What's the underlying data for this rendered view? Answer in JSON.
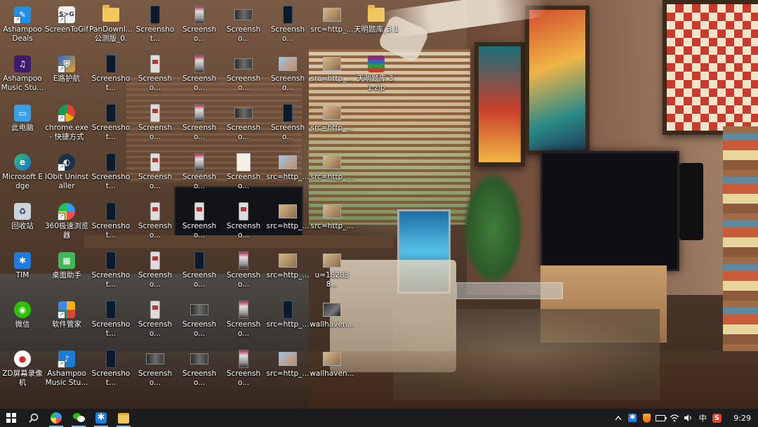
{
  "desktop": {
    "icons": [
      {
        "label": "Ashampoo Deals",
        "kind": "ashampoo"
      },
      {
        "label": "Ashampoo Music Stu...",
        "kind": "music"
      },
      {
        "label": "此电脑",
        "kind": "pc"
      },
      {
        "label": "Microsoft Edge",
        "kind": "edge"
      },
      {
        "label": "回收站",
        "kind": "recycle"
      },
      {
        "label": "TIM",
        "kind": "tim"
      },
      {
        "label": "微信",
        "kind": "wechat"
      },
      {
        "label": "ZD屏幕录像机",
        "kind": "zd"
      },
      {
        "label": "ScreenToGif",
        "kind": "stg"
      },
      {
        "label": "E路护航",
        "kind": "elu"
      },
      {
        "label": "chrome.exe - 快捷方式",
        "kind": "chrome"
      },
      {
        "label": "IObit Uninstaller",
        "kind": "iobit"
      },
      {
        "label": "360极速浏览器",
        "kind": "360"
      },
      {
        "label": "桌面助手",
        "kind": "desk"
      },
      {
        "label": "软件管家",
        "kind": "soft"
      },
      {
        "label": "Ashampoo Music Stu...",
        "kind": "ashampoo2"
      },
      {
        "label": "PanDownl... 公测版_0.0....",
        "kind": "folder"
      },
      {
        "label": "Screenshot...",
        "kind": "phone"
      },
      {
        "label": "Screenshot...",
        "kind": "phone"
      },
      {
        "label": "Screenshot...",
        "kind": "phone"
      },
      {
        "label": "Screenshot...",
        "kind": "phone"
      },
      {
        "label": "Screenshot...",
        "kind": "phone"
      },
      {
        "label": "Screenshot...",
        "kind": "phone"
      },
      {
        "label": "Screenshot...",
        "kind": "phone"
      },
      {
        "label": "Screenshot...",
        "kind": "phone"
      },
      {
        "label": "Screensho...",
        "kind": "phone-light"
      },
      {
        "label": "Screensho...",
        "kind": "phone-light"
      },
      {
        "label": "Screensho...",
        "kind": "phone-light"
      },
      {
        "label": "Screensho...",
        "kind": "phone-light"
      },
      {
        "label": "Screensho...",
        "kind": "phone-light"
      },
      {
        "label": "Screensho...",
        "kind": "phone-light"
      },
      {
        "label": "Screensho...",
        "kind": "wide"
      },
      {
        "label": "Screensho...",
        "kind": "tall"
      },
      {
        "label": "Screensho...",
        "kind": "tall"
      },
      {
        "label": "Screensho...",
        "kind": "tall"
      },
      {
        "label": "Screensho...",
        "kind": "tall"
      },
      {
        "label": "Screensho...",
        "kind": "phone-light"
      },
      {
        "label": "Screensho...",
        "kind": "phone"
      },
      {
        "label": "Screensho...",
        "kind": "wide"
      },
      {
        "label": "Screensho...",
        "kind": "wide"
      },
      {
        "label": "Screensho...",
        "kind": "wide"
      },
      {
        "label": "Screensho...",
        "kind": "wide"
      },
      {
        "label": "Screensho...",
        "kind": "wide"
      },
      {
        "label": "Screensho...",
        "kind": "doc"
      },
      {
        "label": "Screensho...",
        "kind": "phone-light"
      },
      {
        "label": "Screensho...",
        "kind": "tall"
      },
      {
        "label": "Screensho...",
        "kind": "tall"
      },
      {
        "label": "Screensho...",
        "kind": "tall"
      },
      {
        "label": "Screensho...",
        "kind": "phone"
      },
      {
        "label": "Screensho...",
        "kind": "photo-blue"
      },
      {
        "label": "Screensho...",
        "kind": "phone"
      },
      {
        "label": "src=http_...",
        "kind": "photo-blue"
      },
      {
        "label": "src=http_...",
        "kind": "photo"
      },
      {
        "label": "src=http_...",
        "kind": "photo"
      },
      {
        "label": "src=http_...",
        "kind": "phone"
      },
      {
        "label": "src=http_...",
        "kind": "photo-blue"
      },
      {
        "label": "src=http_...",
        "kind": "photo"
      },
      {
        "label": "src=http_...",
        "kind": "photo"
      },
      {
        "label": "src=http_...",
        "kind": "photo"
      },
      {
        "label": "src=http_...",
        "kind": "photo"
      },
      {
        "label": "src=http_...",
        "kind": "photo"
      },
      {
        "label": "u=182838...",
        "kind": "photo"
      },
      {
        "label": "wallhaven...",
        "kind": "photo-dark"
      },
      {
        "label": "wallhaven...",
        "kind": "photo"
      },
      {
        "label": "天明题库_3.1",
        "kind": "folder"
      },
      {
        "label": "天明题库 3.1.zip",
        "kind": "winrar"
      }
    ]
  },
  "taskbar": {
    "apps": [
      {
        "name": "360 browser",
        "active": true
      },
      {
        "name": "WeChat",
        "active": true
      },
      {
        "name": "TIM",
        "active": true
      },
      {
        "name": "File Explorer",
        "active": true
      }
    ],
    "tray": {
      "ime": "中",
      "time": "9:29"
    }
  },
  "colors": {
    "taskbar_bg": "#1c1c1c",
    "active_indicator": "#7fb6ea",
    "label_text": "#ffffff"
  }
}
